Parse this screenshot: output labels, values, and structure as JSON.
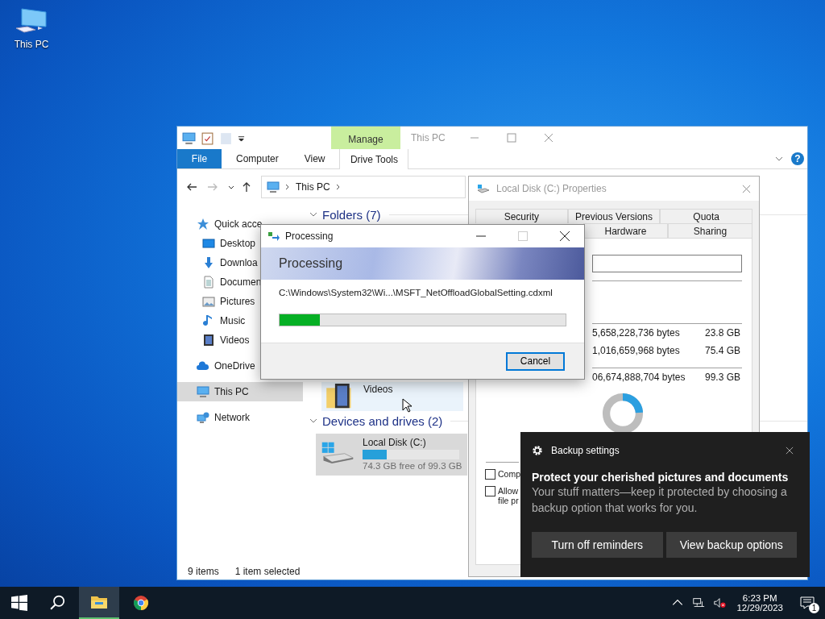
{
  "desktop": {
    "icons": [
      {
        "label": "This PC"
      }
    ]
  },
  "explorer": {
    "title": "This PC",
    "context_group": "Manage",
    "help": "?",
    "ribbon_tabs": [
      {
        "label": "File",
        "kind": "file"
      },
      {
        "label": "Computer",
        "kind": "tab",
        "selected": false
      },
      {
        "label": "View",
        "kind": "tab",
        "selected": false
      },
      {
        "label": "Drive Tools",
        "kind": "tab",
        "selected": true
      }
    ],
    "address": [
      "This PC"
    ],
    "nav": [
      {
        "label": "Quick acce",
        "kind": "star",
        "selected": false,
        "children": [
          {
            "label": "Desktop",
            "kind": "desktop",
            "selected": false
          },
          {
            "label": "Downloa",
            "kind": "download",
            "selected": false
          },
          {
            "label": "Documen",
            "kind": "document",
            "selected": false
          },
          {
            "label": "Pictures",
            "kind": "pictures",
            "selected": false
          },
          {
            "label": "Music",
            "kind": "music",
            "selected": false
          },
          {
            "label": "Videos",
            "kind": "videos",
            "selected": false
          }
        ]
      },
      {
        "label": "OneDrive",
        "kind": "cloud",
        "selected": false
      },
      {
        "label": "This PC",
        "kind": "pc",
        "selected": true
      },
      {
        "label": "Network",
        "kind": "network",
        "selected": false
      }
    ],
    "sections": [
      {
        "title": "Folders (7)",
        "expanded": true,
        "items": [
          {
            "label": "Videos",
            "kind": "videos",
            "selected": false
          }
        ]
      },
      {
        "title": "Devices and drives (2)",
        "expanded": true,
        "items": [
          {
            "label": "Local Disk (C:)",
            "kind": "drive",
            "level": 0.25,
            "detail": "74.3 GB free of 99.3 GB",
            "selected": true
          }
        ]
      }
    ],
    "status": [
      "9 items",
      "1 item selected"
    ]
  },
  "properties": {
    "title": "Local Disk (C:) Properties",
    "tab_rows": [
      [
        {
          "label": "Security",
          "selected": false
        },
        {
          "label": "Previous Versions",
          "selected": false
        },
        {
          "label": "Quota",
          "selected": false
        }
      ],
      [
        {
          "label": "Hardware",
          "selected": false
        },
        {
          "label": "Sharing",
          "selected": false
        }
      ]
    ],
    "rows": [
      {
        "bytes": "5,658,228,736 bytes",
        "size": "23.8 GB"
      },
      {
        "bytes": "1,016,659,968 bytes",
        "size": "75.4 GB"
      },
      {
        "bytes": "06,674,888,704 bytes",
        "size": "99.3 GB"
      }
    ],
    "usage": {
      "level": 0.24
    },
    "options": [
      {
        "lines": [
          "Comp"
        ],
        "checked": false
      },
      {
        "lines": [
          "Allow",
          "file pr"
        ],
        "checked": false
      }
    ]
  },
  "processing": {
    "title": "Processing",
    "heading": "Processing",
    "path": "C:\\Windows\\System32\\Wi...\\MSFT_NetOffloadGlobalSetting.cdxml",
    "progress": {
      "level": 0.14
    },
    "buttons": [
      "Cancel"
    ]
  },
  "toast": {
    "app": "Backup settings",
    "title": "Protect your cherished pictures and documents",
    "body": "Your stuff matters—keep it protected by choosing a backup option that works for you.",
    "buttons": [
      "Turn off reminders",
      "View backup options"
    ]
  },
  "taskbar": {
    "pinned": [
      {
        "kind": "explorer",
        "selected": true
      },
      {
        "kind": "chrome",
        "selected": false
      }
    ],
    "tray": {
      "volume_muted": true,
      "time": "6:23 PM",
      "date": "12/29/2023",
      "notifications": "1"
    }
  }
}
